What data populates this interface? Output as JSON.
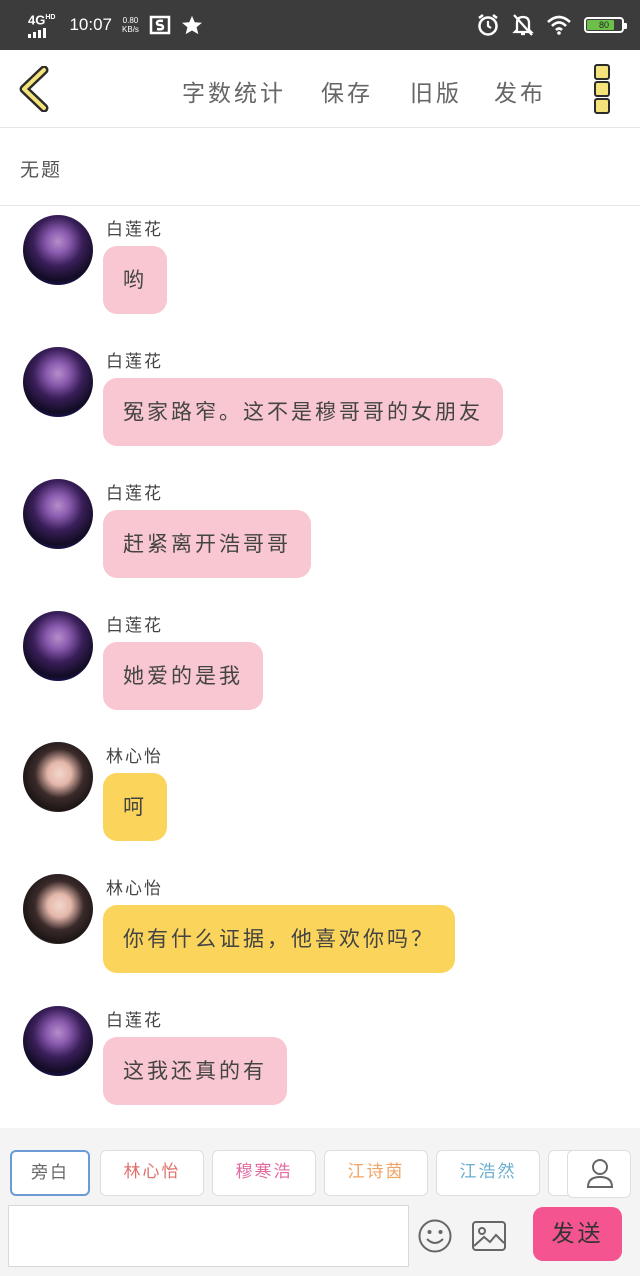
{
  "status_bar": {
    "network": "4G",
    "network_sup": "HD",
    "time": "10:07",
    "speed_value": "0.80",
    "speed_unit": "KB/s",
    "battery": "80",
    "battery_level": 0.8,
    "icons": [
      "signal-icon",
      "shield-s-icon",
      "star-icon",
      "alarm-icon",
      "mute-bell-icon",
      "wifi-icon",
      "battery-icon"
    ]
  },
  "toolbar": {
    "back_icon": "chevron-left-icon",
    "items": [
      "字数统计",
      "保存",
      "旧版",
      "发布"
    ],
    "more_icon": "more-vertical-icon"
  },
  "title": "无题",
  "messages": [
    {
      "sender": "白莲花",
      "avatar": "avatar-bailianhua",
      "text": "哟",
      "color": "#f8c7d1"
    },
    {
      "sender": "白莲花",
      "avatar": "avatar-bailianhua",
      "text": "冤家路窄。这不是穆哥哥的女朋友",
      "color": "#f8c7d1"
    },
    {
      "sender": "白莲花",
      "avatar": "avatar-bailianhua",
      "text": "赶紧离开浩哥哥",
      "color": "#f8c7d1"
    },
    {
      "sender": "白莲花",
      "avatar": "avatar-bailianhua",
      "text": "她爱的是我",
      "color": "#f8c7d1"
    },
    {
      "sender": "林心怡",
      "avatar": "avatar-linxinyi",
      "text": "呵",
      "color": "#fbd55b"
    },
    {
      "sender": "林心怡",
      "avatar": "avatar-linxinyi",
      "text": "你有什么证据，他喜欢你吗？",
      "color": "#fbd55b"
    },
    {
      "sender": "白莲花",
      "avatar": "avatar-bailianhua",
      "text": "这我还真的有",
      "color": "#f8c7d1"
    }
  ],
  "characters": [
    {
      "name": "旁白",
      "color": "#666666"
    },
    {
      "name": "林心怡",
      "color": "#e0706a"
    },
    {
      "name": "穆寒浩",
      "color": "#e36aa0"
    },
    {
      "name": "江诗茵",
      "color": "#f0a464"
    },
    {
      "name": "江浩然",
      "color": "#6aaed0"
    }
  ],
  "input": {
    "value": "",
    "placeholder": ""
  },
  "send_label": "发送",
  "icons": {
    "user": "user-icon",
    "emoji": "emoji-icon",
    "image": "image-icon"
  },
  "colors": {
    "status_bar_bg": "#3c3c3c",
    "bubble_pink": "#f8c7d1",
    "bubble_yellow": "#fbd55b",
    "send_button": "#f4548f",
    "active_chip_border": "#6b9bd6"
  }
}
